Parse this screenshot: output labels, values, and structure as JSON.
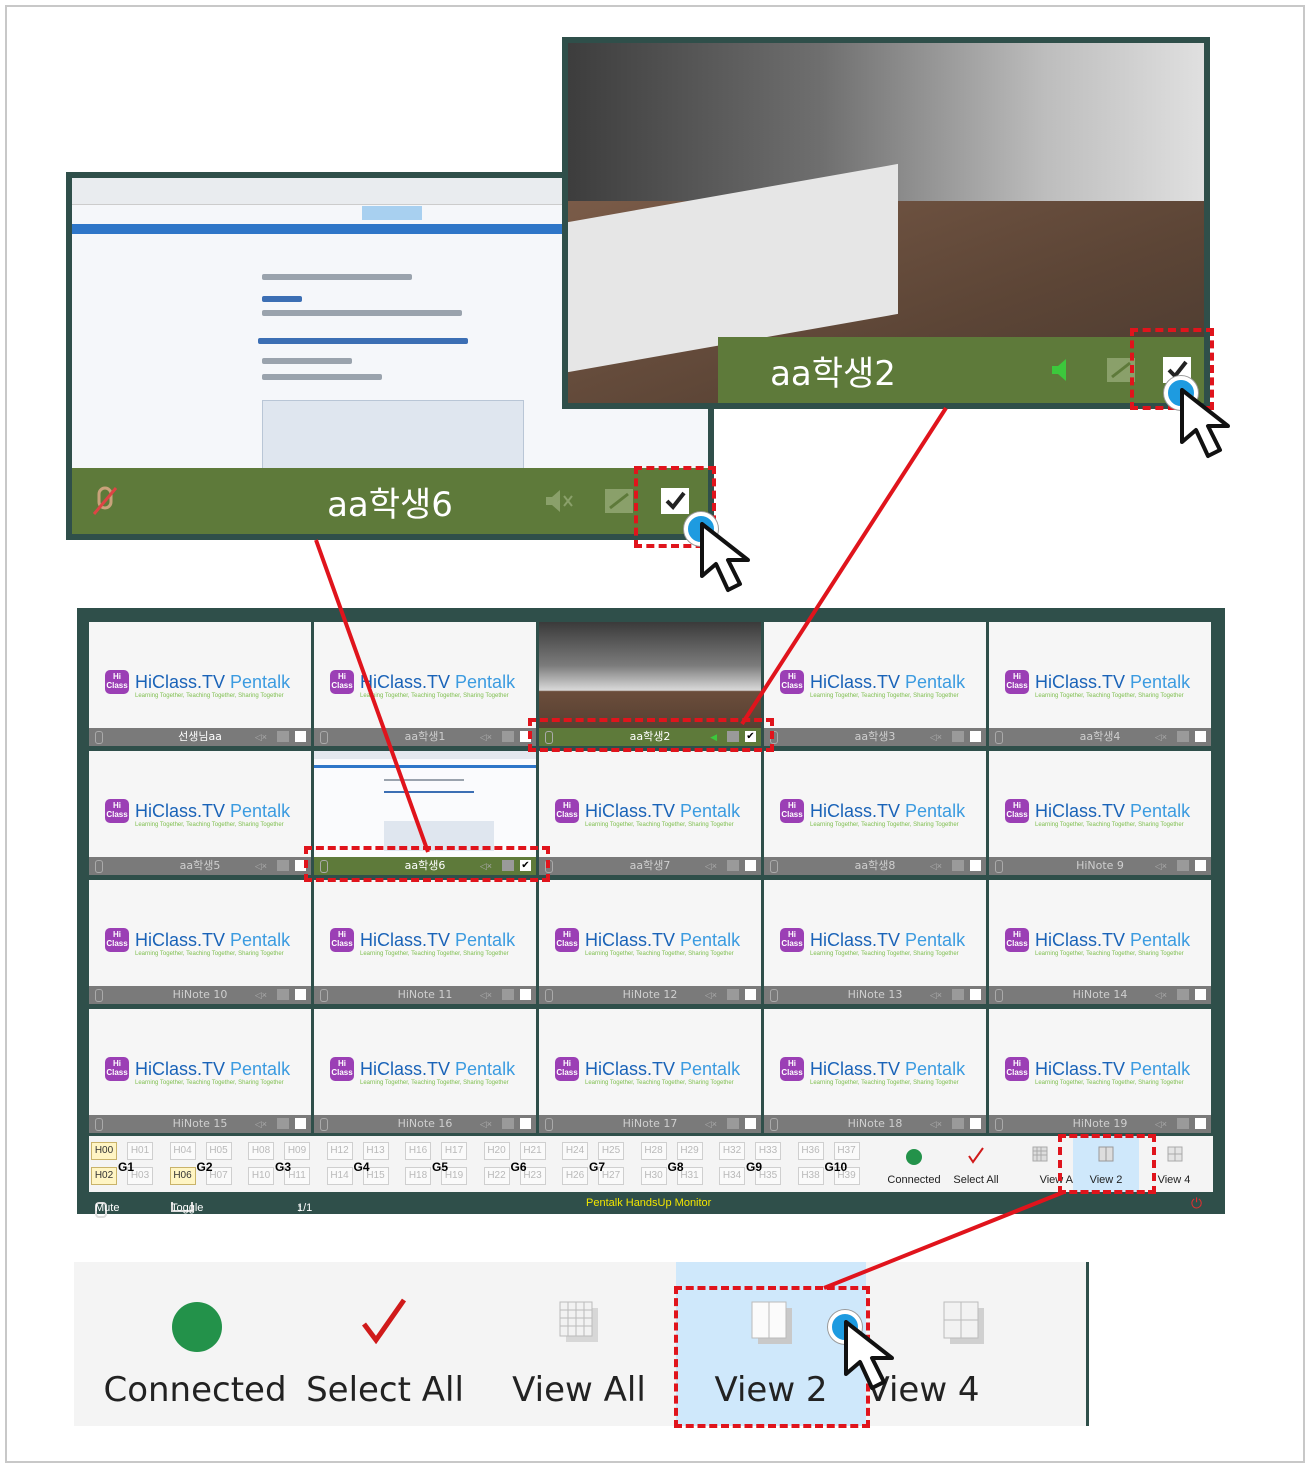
{
  "zoom_a": {
    "name": "aa학생6"
  },
  "zoom_b": {
    "name": "aa학생2"
  },
  "brand": {
    "hiclass": "HiClass.TV",
    "pentalk": "Pentalk",
    "tagline": "Learning Together, Teaching Together, Sharing Together",
    "icon_text": "Hi Class"
  },
  "tiles": [
    {
      "name": "선생님aa"
    },
    {
      "name": "aa학생1"
    },
    {
      "name": "aa학생2"
    },
    {
      "name": "aa학생3"
    },
    {
      "name": "aa학생4"
    },
    {
      "name": "aa학생5"
    },
    {
      "name": "aa학생6"
    },
    {
      "name": "aa학생7"
    },
    {
      "name": "aa학생8"
    },
    {
      "name": "HiNote 9"
    },
    {
      "name": "HiNote 10"
    },
    {
      "name": "HiNote 11"
    },
    {
      "name": "HiNote 12"
    },
    {
      "name": "HiNote 13"
    },
    {
      "name": "HiNote 14"
    },
    {
      "name": "HiNote 15"
    },
    {
      "name": "HiNote 16"
    },
    {
      "name": "HiNote 17"
    },
    {
      "name": "HiNote 18"
    },
    {
      "name": "HiNote 19"
    }
  ],
  "groups": [
    {
      "label": "G1",
      "top": [
        "H00",
        "H01"
      ],
      "bottom": [
        "H02",
        "H03"
      ]
    },
    {
      "label": "G2",
      "top": [
        "H04",
        "H05"
      ],
      "bottom": [
        "H06",
        "H07"
      ]
    },
    {
      "label": "G3",
      "top": [
        "H08",
        "H09"
      ],
      "bottom": [
        "H10",
        "H11"
      ]
    },
    {
      "label": "G4",
      "top": [
        "H12",
        "H13"
      ],
      "bottom": [
        "H14",
        "H15"
      ]
    },
    {
      "label": "G5",
      "top": [
        "H16",
        "H17"
      ],
      "bottom": [
        "H18",
        "H19"
      ]
    },
    {
      "label": "G6",
      "top": [
        "H20",
        "H21"
      ],
      "bottom": [
        "H22",
        "H23"
      ]
    },
    {
      "label": "G7",
      "top": [
        "H24",
        "H25"
      ],
      "bottom": [
        "H26",
        "H27"
      ]
    },
    {
      "label": "G8",
      "top": [
        "H28",
        "H29"
      ],
      "bottom": [
        "H30",
        "H31"
      ]
    },
    {
      "label": "G9",
      "top": [
        "H32",
        "H33"
      ],
      "bottom": [
        "H34",
        "H35"
      ]
    },
    {
      "label": "G10",
      "top": [
        "H36",
        "H37"
      ],
      "bottom": [
        "H38",
        "H39"
      ]
    }
  ],
  "toolbar": {
    "connected": "Connected",
    "select_all": "Select All",
    "view_all": "View All",
    "view_all_clipped": "View A",
    "view2": "View 2",
    "view4": "View 4"
  },
  "status": {
    "mute": "Mute",
    "toggle": "Toggle Status",
    "page": "1/1 Page",
    "title": "Pentalk HandsUp Monitor"
  },
  "colors": {
    "window_frame": "#2f4f4a",
    "active_bar": "#5e7a3a",
    "highlight": "#e0141c",
    "connected": "#23924a",
    "selected_view": "#cfe8fb",
    "title_text": "#f2e600"
  }
}
